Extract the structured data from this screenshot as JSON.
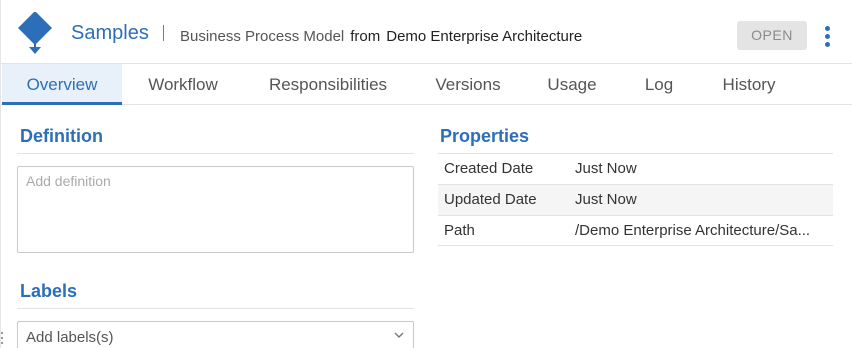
{
  "header": {
    "title": "Samples",
    "model_type": "Business Process Model",
    "from_label": "from",
    "source": "Demo Enterprise Architecture",
    "open_button": "OPEN",
    "logo_icon": "process-diagram-icon",
    "menu_icon": "kebab-menu-icon",
    "accent": "#2c6fb8"
  },
  "tabs": [
    {
      "label": "Overview",
      "active": true
    },
    {
      "label": "Workflow",
      "active": false
    },
    {
      "label": "Responsibilities",
      "active": false
    },
    {
      "label": "Versions",
      "active": false
    },
    {
      "label": "Usage",
      "active": false
    },
    {
      "label": "Log",
      "active": false
    },
    {
      "label": "History",
      "active": false
    }
  ],
  "definition": {
    "title": "Definition",
    "placeholder": "Add definition"
  },
  "labels": {
    "title": "Labels",
    "placeholder": "Add labels(s)",
    "dropdown_icon": "chevron-down-icon"
  },
  "properties": {
    "title": "Properties",
    "rows": [
      {
        "key": "Created Date",
        "value": "Just Now"
      },
      {
        "key": "Updated Date",
        "value": "Just Now"
      },
      {
        "key": "Path",
        "value": "/Demo Enterprise Architecture/Sa..."
      }
    ]
  }
}
